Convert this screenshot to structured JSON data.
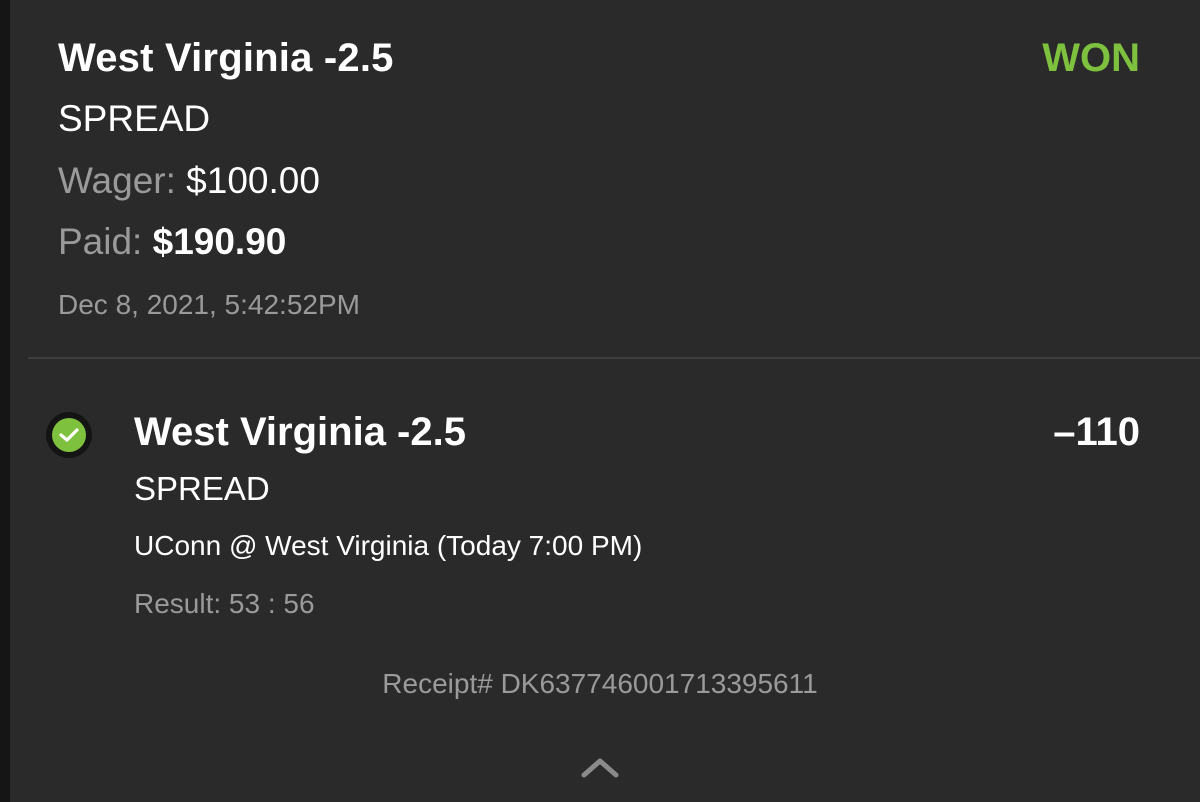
{
  "bet": {
    "title": "West Virginia -2.5",
    "status": "WON",
    "type": "SPREAD",
    "wager_label": "Wager:",
    "wager_value": "$100.00",
    "paid_label": "Paid:",
    "paid_value": "$190.90",
    "timestamp": "Dec 8, 2021, 5:42:52PM"
  },
  "leg": {
    "status_icon": "check-circle-icon",
    "title": "West Virginia -2.5",
    "odds": "–110",
    "type": "SPREAD",
    "matchup": "UConn @ West Virginia (Today 7:00 PM)",
    "result": "Result: 53 : 56"
  },
  "receipt": "Receipt# DK637746001713395611",
  "footer": {
    "collapse_icon": "chevron-up-icon"
  },
  "colors": {
    "background": "#2a2a2a",
    "win_green": "#7ec13f",
    "muted_text": "#9a9a9a"
  }
}
